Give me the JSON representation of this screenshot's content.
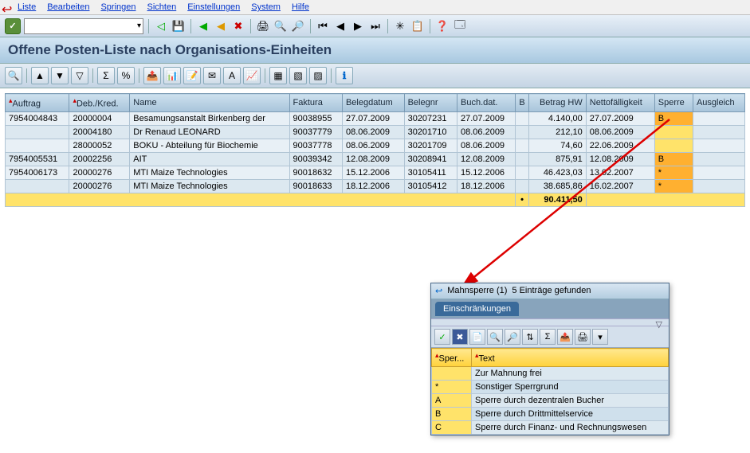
{
  "menu": [
    "Liste",
    "Bearbeiten",
    "Springen",
    "Sichten",
    "Einstellungen",
    "System",
    "Hilfe"
  ],
  "title": "Offene Posten-Liste nach Organisations-Einheiten",
  "columns": [
    "Auftrag",
    "Deb./Kred.",
    "Name",
    "Faktura",
    "Belegdatum",
    "Belegnr",
    "Buch.dat.",
    "B",
    "Betrag HW",
    "Nettofälligkeit",
    "Sperre",
    "Ausgleich"
  ],
  "rows": [
    {
      "auftrag": "7954004843",
      "deb": "20000004",
      "name": "Besamungsanstalt Birkenberg der",
      "faktura": "90038955",
      "belegdatum": "27.07.2009",
      "belegnr": "30207231",
      "buchdat": "27.07.2009",
      "b": "",
      "betrag": "4.140,00",
      "netto": "27.07.2009",
      "sperre": "B",
      "ausgleich": ""
    },
    {
      "auftrag": "",
      "deb": "20004180",
      "name": "Dr Renaud LEONARD",
      "faktura": "90037779",
      "belegdatum": "08.06.2009",
      "belegnr": "30201710",
      "buchdat": "08.06.2009",
      "b": "",
      "betrag": "212,10",
      "netto": "08.06.2009",
      "sperre": "",
      "ausgleich": ""
    },
    {
      "auftrag": "",
      "deb": "28000052",
      "name": "BOKU - Abteilung für Biochemie",
      "faktura": "90037778",
      "belegdatum": "08.06.2009",
      "belegnr": "30201709",
      "buchdat": "08.06.2009",
      "b": "",
      "betrag": "74,60",
      "netto": "22.06.2009",
      "sperre": "",
      "ausgleich": ""
    },
    {
      "auftrag": "7954005531",
      "deb": "20002256",
      "name": "AIT",
      "faktura": "90039342",
      "belegdatum": "12.08.2009",
      "belegnr": "30208941",
      "buchdat": "12.08.2009",
      "b": "",
      "betrag": "875,91",
      "netto": "12.08.2009",
      "sperre": "B",
      "ausgleich": ""
    },
    {
      "auftrag": "7954006173",
      "deb": "20000276",
      "name": "MTI Maize Technologies",
      "faktura": "90018632",
      "belegdatum": "15.12.2006",
      "belegnr": "30105411",
      "buchdat": "15.12.2006",
      "b": "",
      "betrag": "46.423,03",
      "netto": "13.02.2007",
      "sperre": "*",
      "ausgleich": ""
    },
    {
      "auftrag": "",
      "deb": "20000276",
      "name": "MTI Maize Technologies",
      "faktura": "90018633",
      "belegdatum": "18.12.2006",
      "belegnr": "30105412",
      "buchdat": "18.12.2006",
      "b": "",
      "betrag": "38.685,86",
      "netto": "16.02.2007",
      "sperre": "*",
      "ausgleich": ""
    }
  ],
  "total": {
    "label": "•",
    "betrag": "90.411,50"
  },
  "popup": {
    "title_a": "Mahnsperre (1)",
    "title_b": "5 Einträge gefunden",
    "tab": "Einschränkungen",
    "cols": [
      "Sper...",
      "Text"
    ],
    "rows": [
      {
        "key": "",
        "text": "Zur Mahnung frei"
      },
      {
        "key": "*",
        "text": "Sonstiger Sperrgrund"
      },
      {
        "key": "A",
        "text": "Sperre durch dezentralen Bucher"
      },
      {
        "key": "B",
        "text": "Sperre durch Drittmittelservice"
      },
      {
        "key": "C",
        "text": "Sperre durch Finanz- und Rechnungswesen"
      }
    ]
  }
}
